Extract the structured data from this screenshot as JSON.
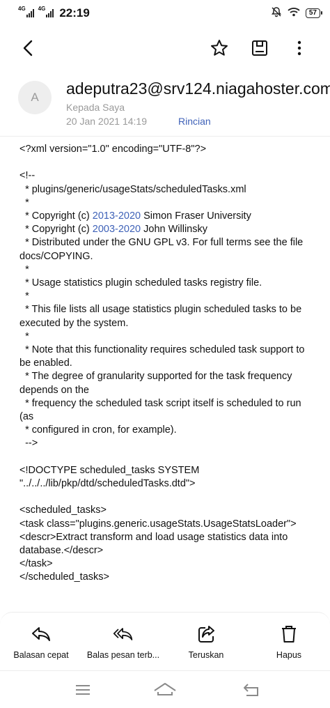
{
  "status_bar": {
    "signal1_label": "4G",
    "signal2_label": "4G",
    "time": "22:19",
    "battery": "57"
  },
  "toolbar": {
    "back_icon": "back-arrow-icon",
    "star_icon": "star-icon",
    "archive_icon": "archive-icon",
    "more_icon": "more-vertical-icon"
  },
  "sender": {
    "avatar_initial": "A",
    "email": "adeputra23@srv124.niagahoster.com",
    "recipient": "Kepada Saya",
    "date": "20 Jan 2021 14:19",
    "details_link": "Rincian"
  },
  "body": {
    "xml_decl": "<?xml version=\"1.0\" encoding=\"UTF-8\"?>",
    "comment_open": "<!--",
    "file_path": "  * plugins/generic/usageStats/scheduledTasks.xml",
    "star1": "  *",
    "copyright1_prefix": "  * Copyright (c) ",
    "copyright1_years": "2013-2020",
    "copyright1_suffix": " Simon Fraser University",
    "copyright2_prefix": "  * Copyright (c) ",
    "copyright2_years": "2003-2020",
    "copyright2_suffix": " John Willinsky",
    "license": "  * Distributed under the GNU GPL v3. For full terms see the file docs/COPYING.",
    "star2": "  *",
    "description1": "  * Usage statistics plugin scheduled tasks registry file.",
    "star3": "  *",
    "description2": "  * This file lists all usage statistics plugin scheduled tasks to be executed by the system.",
    "star4": "  *",
    "note1": "  * Note that this functionality requires scheduled task support to be enabled.",
    "note2": "  * The degree of granularity supported for the task frequency depends on the",
    "note3": "  * frequency the scheduled task script itself is scheduled to run (as",
    "note4": "  * configured in cron, for example).",
    "comment_close": "  -->",
    "doctype": "<!DOCTYPE scheduled_tasks SYSTEM \"../../../lib/pkp/dtd/scheduledTasks.dtd\">",
    "open_tasks": "<scheduled_tasks>",
    "task_open": "<task class=\"plugins.generic.usageStats.UsageStatsLoader\">",
    "descr": "<descr>Extract transform and load usage statistics data into database.</descr>",
    "task_close": "</task>",
    "close_tasks": "</scheduled_tasks>"
  },
  "actions": [
    {
      "label": "Balasan cepat",
      "icon": "reply-icon"
    },
    {
      "label": "Balas pesan terb...",
      "icon": "reply-all-icon"
    },
    {
      "label": "Teruskan",
      "icon": "forward-icon"
    },
    {
      "label": "Hapus",
      "icon": "trash-icon"
    }
  ],
  "nav_bar": {
    "menu_icon": "menu-icon",
    "home_icon": "home-icon",
    "back_icon": "system-back-icon"
  },
  "colors": {
    "link": "#3f62b8",
    "muted": "#9a9a9a",
    "avatar_bg": "#eeeeee"
  }
}
